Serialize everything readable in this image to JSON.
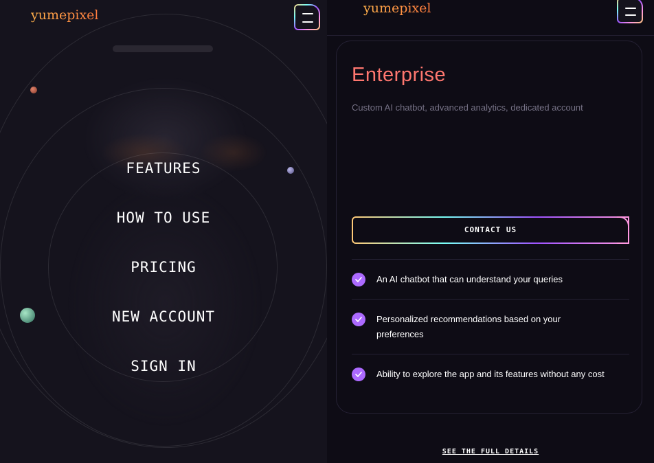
{
  "brand": {
    "logo_text": "yumepixel"
  },
  "menu": {
    "items": [
      {
        "label": "Features"
      },
      {
        "label": "How to use"
      },
      {
        "label": "Pricing"
      },
      {
        "label": "New account"
      },
      {
        "label": "Sign in"
      }
    ]
  },
  "pricing": {
    "title": "Enterprise",
    "description": "Custom AI chatbot, advanced analytics, dedicated account",
    "cta_label": "CONTACT US",
    "features": [
      "An AI chatbot that can understand your queries",
      "Personalized recommendations based on your preferences",
      "Ability to explore the app and its features without any cost"
    ],
    "see_details_label": "SEE THE FULL DETAILS"
  },
  "colors": {
    "background": "#0e0c15",
    "title_accent": "#ff776f",
    "check_accent": "#ac6aff",
    "logo_gradient_start": "#ffb04b",
    "logo_gradient_end": "#ff7a3d"
  },
  "icons": {
    "menu": "hamburger-menu-icon",
    "feature_check": "check-icon"
  }
}
